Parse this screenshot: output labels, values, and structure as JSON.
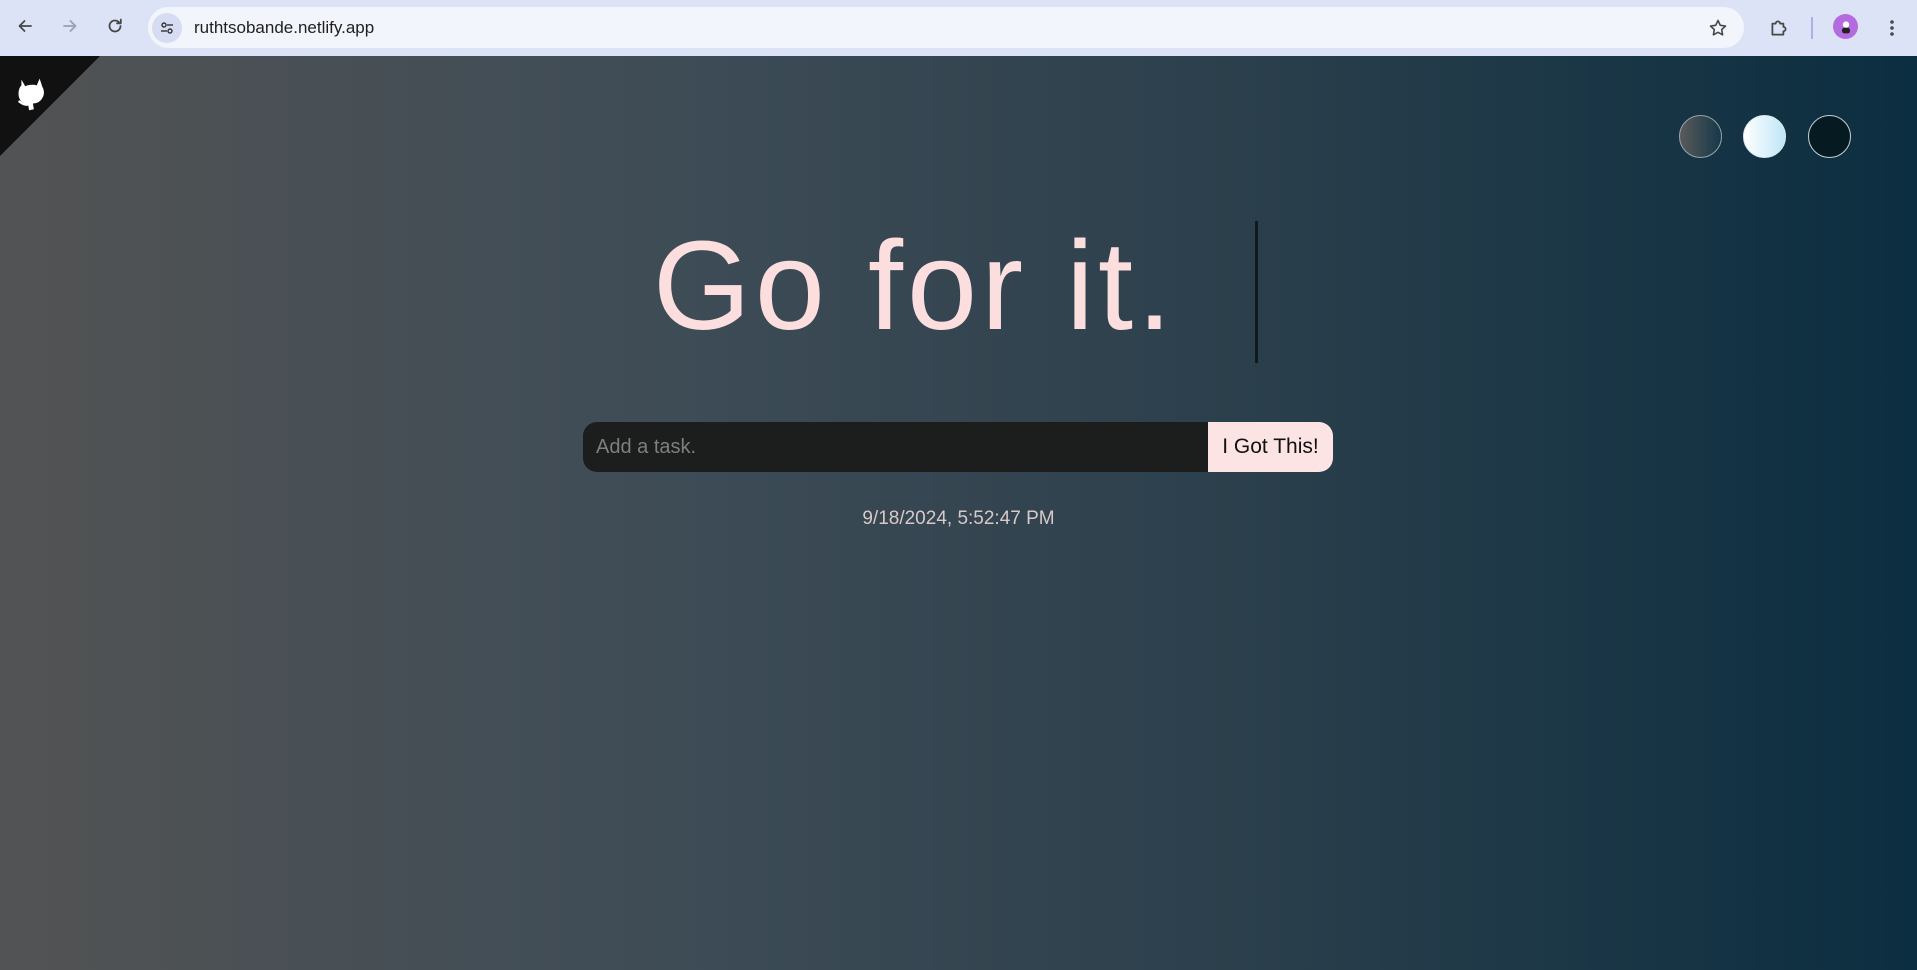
{
  "browser": {
    "url": "ruthtsobande.netlify.app",
    "icons": {
      "back": "arrow-left-icon",
      "forward": "arrow-right-icon",
      "reload": "reload-icon",
      "site_info": "tune-icon",
      "bookmark": "star-icon",
      "extensions": "puzzle-icon",
      "profile": "avatar-icon",
      "menu": "kebab-menu-icon"
    },
    "colors": {
      "toolbar": "#dde3f7",
      "omnibox": "#f3f5fc",
      "avatar": "#b56be0"
    }
  },
  "page": {
    "corner_icon": "github-octocat-icon",
    "theme_options": [
      {
        "name": "dark-gradient",
        "color": "#3d4a53"
      },
      {
        "name": "light-gradient",
        "color": "#e6f5fc"
      },
      {
        "name": "dark",
        "color": "#061a22"
      }
    ],
    "headline": "Go for it.",
    "task_input": {
      "placeholder": "Add a task.",
      "value": ""
    },
    "submit_label": "I Got This!",
    "datetime": "9/18/2024, 5:52:47 PM",
    "colors": {
      "headline": "#fcdede",
      "button_bg": "#fbe4e3",
      "input_bg": "#1c1d1d"
    }
  }
}
